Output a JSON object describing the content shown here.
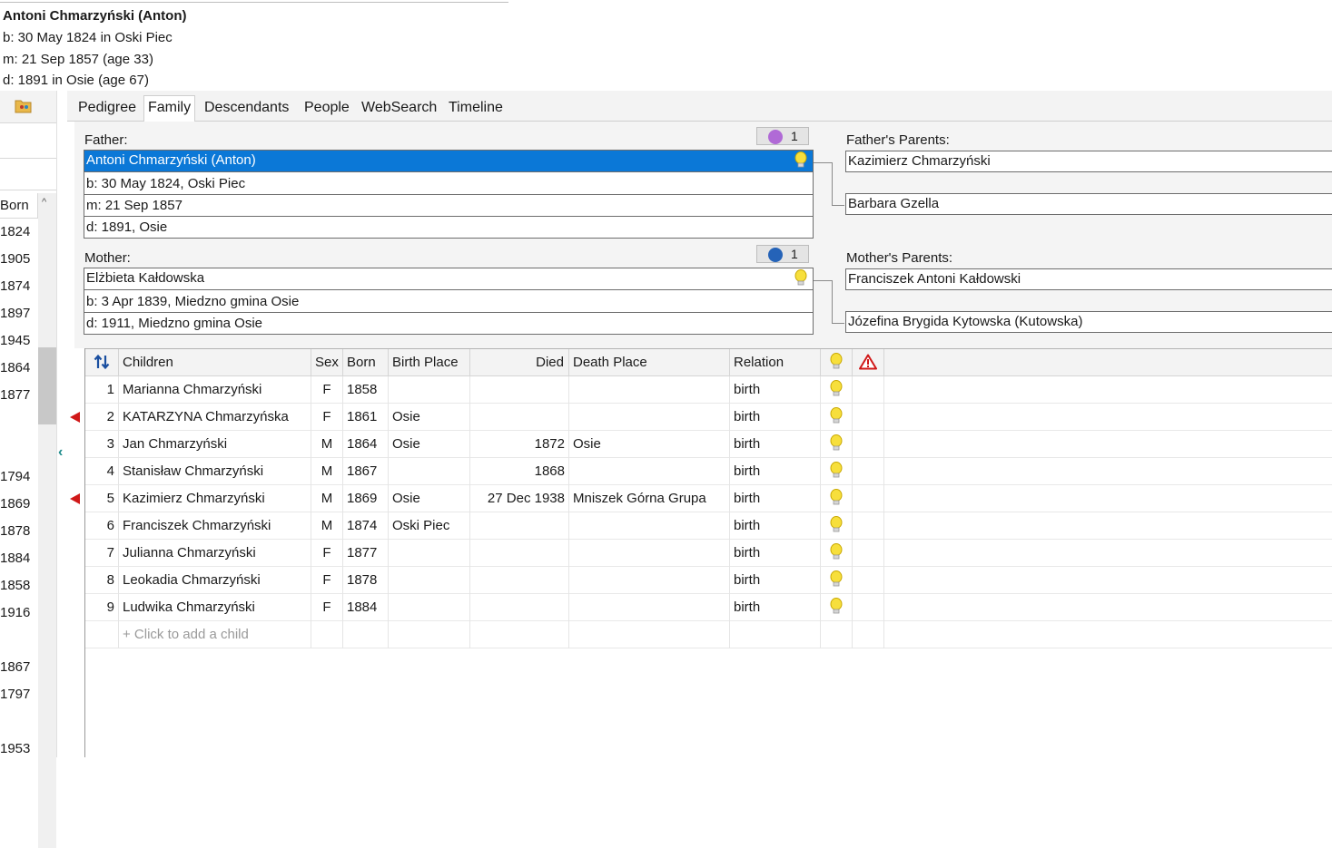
{
  "summary": {
    "name": "Antoni Chmarzyński (Anton)",
    "birth": "b: 30 May 1824 in Oski Piec",
    "marriage": "m: 21 Sep 1857 (age 33)",
    "death": "d: 1891 in Osie (age 67)"
  },
  "left_panel": {
    "column_header": "Born",
    "years": [
      "1824",
      "1905",
      "1874",
      "1897",
      "1945",
      "1864",
      "1877",
      "1794",
      "1869",
      "1878",
      "1884",
      "1858",
      "1916",
      "1867",
      "1797",
      "1953"
    ]
  },
  "tabs": [
    {
      "label": "Pedigree"
    },
    {
      "label": "Family"
    },
    {
      "label": "Descendants"
    },
    {
      "label": "People"
    },
    {
      "label": "WebSearch"
    },
    {
      "label": "Timeline"
    }
  ],
  "family": {
    "father": {
      "label": "Father:",
      "name": "Antoni Chmarzyński (Anton)",
      "birth": "b: 30 May 1824, Oski Piec",
      "marriage": "m: 21 Sep 1857",
      "death": "d: 1891, Osie",
      "badge_count": "1"
    },
    "mother": {
      "label": "Mother:",
      "name": "Elżbieta Kałdowska",
      "birth": "b: 3 Apr 1839, Miedzno gmina Osie",
      "death": "d: 1911, Miedzno gmina Osie",
      "badge_count": "1"
    },
    "father_parents": {
      "label": "Father's Parents:",
      "father": "Kazimierz Chmarzyński",
      "mother": "Barbara Gzella"
    },
    "mother_parents": {
      "label": "Mother's Parents:",
      "father": "Franciszek Antoni Kałdowski",
      "mother": "Józefina Brygida Kytowska (Kutowska)"
    }
  },
  "children_table": {
    "headers": {
      "children": "Children",
      "sex": "Sex",
      "born": "Born",
      "birth_place": "Birth Place",
      "died": "Died",
      "death_place": "Death Place",
      "relation": "Relation"
    },
    "rows": [
      {
        "num": "1",
        "name": "Marianna Chmarzyński",
        "sex": "F",
        "born": "1858",
        "birth_place": "",
        "died": "",
        "death_place": "",
        "relation": "birth",
        "flag": false
      },
      {
        "num": "2",
        "name": "KATARZYNA Chmarzyńska",
        "sex": "F",
        "born": "1861",
        "birth_place": "Osie",
        "died": "",
        "death_place": "",
        "relation": "birth",
        "flag": true
      },
      {
        "num": "3",
        "name": "Jan Chmarzyński",
        "sex": "M",
        "born": "1864",
        "birth_place": "Osie",
        "died": "1872",
        "death_place": "Osie",
        "relation": "birth",
        "flag": false
      },
      {
        "num": "4",
        "name": "Stanisław Chmarzyński",
        "sex": "M",
        "born": "1867",
        "birth_place": "",
        "died": "1868",
        "death_place": "",
        "relation": "birth",
        "flag": false
      },
      {
        "num": "5",
        "name": "Kazimierz Chmarzyński",
        "sex": "M",
        "born": "1869",
        "birth_place": "Osie",
        "died": "27 Dec 1938",
        "death_place": "Mniszek Górna Grupa",
        "relation": "birth",
        "flag": true
      },
      {
        "num": "6",
        "name": "Franciszek Chmarzyński",
        "sex": "M",
        "born": "1874",
        "birth_place": "Oski Piec",
        "died": "",
        "death_place": "",
        "relation": "birth",
        "flag": false
      },
      {
        "num": "7",
        "name": "Julianna Chmarzyński",
        "sex": "F",
        "born": "1877",
        "birth_place": "",
        "died": "",
        "death_place": "",
        "relation": "birth",
        "flag": false
      },
      {
        "num": "8",
        "name": "Leokadia Chmarzyński",
        "sex": "F",
        "born": "1878",
        "birth_place": "",
        "died": "",
        "death_place": "",
        "relation": "birth",
        "flag": false
      },
      {
        "num": "9",
        "name": "Ludwika Chmarzyński",
        "sex": "F",
        "born": "1884",
        "birth_place": "",
        "died": "",
        "death_place": "",
        "relation": "birth",
        "flag": false
      }
    ],
    "add_child": "+ Click to add a child"
  },
  "colors": {
    "selection": "#0b78d7",
    "bulb": "#f2d21b",
    "warning": "#d01818",
    "accent_teal": "#1b8a8a",
    "badge_male": "#2563b8",
    "badge_female": "#b06ad6"
  },
  "icons": {
    "sort": "sort-arrows-icon",
    "hint": "lightbulb-icon",
    "warning": "warning-triangle-icon",
    "folder": "folder-icon",
    "flag": "red-flag-icon"
  }
}
